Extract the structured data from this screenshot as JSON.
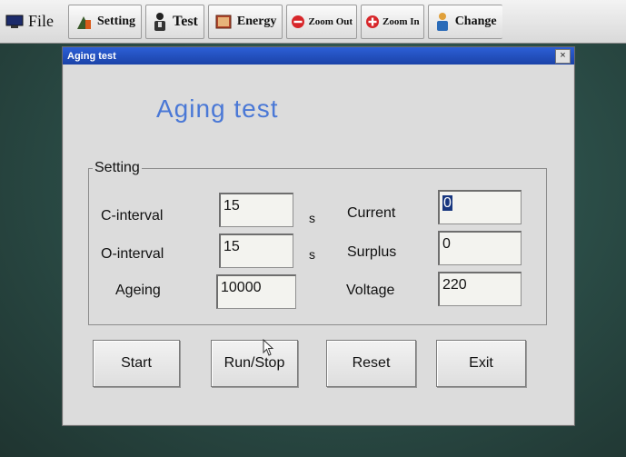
{
  "menubar": {
    "items": [
      {
        "label": "File",
        "icon": "monitor-icon"
      },
      {
        "label": "Setting",
        "icon": "setting-icon"
      },
      {
        "label": "Test",
        "icon": "test-icon"
      },
      {
        "label": "Energy",
        "icon": "book-icon"
      },
      {
        "label": "Zoom Out",
        "icon": "zoom-out-icon"
      },
      {
        "label": "Zoom In",
        "icon": "zoom-in-icon"
      },
      {
        "label": "Change",
        "icon": "change-icon"
      }
    ]
  },
  "dialog": {
    "title": "Aging test",
    "heading": "Aging test",
    "close_label": "×",
    "group_label": "Setting",
    "fields": {
      "c_interval": {
        "label": "C-interval",
        "value": "15",
        "unit": "s"
      },
      "o_interval": {
        "label": "O-interval",
        "value": "15",
        "unit": "s"
      },
      "ageing": {
        "label": "Ageing",
        "value": "10000"
      },
      "current": {
        "label": "Current",
        "value": "0"
      },
      "surplus": {
        "label": "Surplus",
        "value": "0"
      },
      "voltage": {
        "label": "Voltage",
        "value": "220"
      }
    },
    "buttons": {
      "start": "Start",
      "run_stop": "Run/Stop",
      "reset": "Reset",
      "exit": "Exit"
    }
  },
  "colors": {
    "titlebar": "#1b43a8",
    "heading": "#4a78d6"
  }
}
